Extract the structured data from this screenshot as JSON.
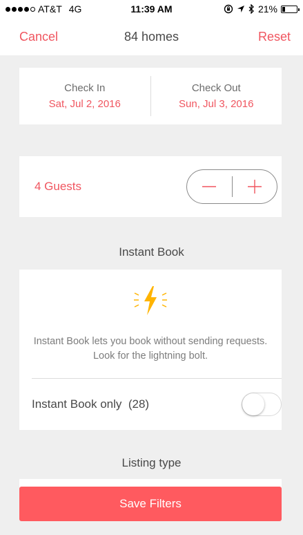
{
  "status_bar": {
    "carrier": "AT&T",
    "network": "4G",
    "time": "11:39 AM",
    "battery_percent": "21%",
    "battery_level": 0.21,
    "signal_bars_filled": 4,
    "signal_bars_total": 5
  },
  "nav": {
    "cancel_label": "Cancel",
    "title": "84 homes",
    "reset_label": "Reset"
  },
  "dates": {
    "check_in_label": "Check In",
    "check_in_value": "Sat, Jul 2, 2016",
    "check_out_label": "Check Out",
    "check_out_value": "Sun, Jul 3, 2016"
  },
  "guests": {
    "label": "4 Guests"
  },
  "instant_book": {
    "section_title": "Instant Book",
    "description": "Instant Book lets you book without sending requests. Look for the lightning bolt.",
    "toggle_label": "Instant Book only  (28)",
    "toggle_on": false
  },
  "listing_type": {
    "section_title": "Listing type"
  },
  "save_filters_label": "Save Filters",
  "colors": {
    "accent": "#f0555f",
    "save_button": "#ff5a5f",
    "bolt": "#ffb400",
    "background": "#efefef"
  },
  "icons": {
    "minus": "minus-icon",
    "plus": "plus-icon",
    "bolt": "lightning-bolt-icon",
    "bluetooth": "bluetooth-icon",
    "location": "location-arrow-icon",
    "rotation_lock": "rotation-lock-icon"
  }
}
